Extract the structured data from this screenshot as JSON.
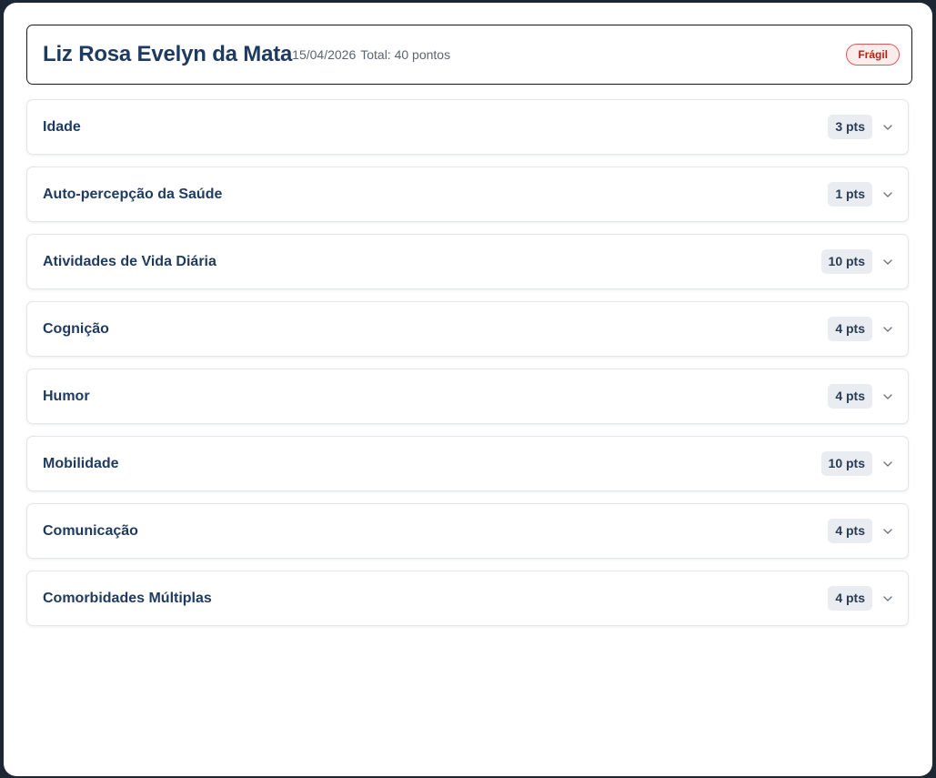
{
  "header": {
    "patient_name": "Liz Rosa Evelyn da Mata",
    "date": "15/04/2026",
    "total": "Total: 40 pontos",
    "status": "Frágil"
  },
  "sections": [
    {
      "label": "Idade",
      "points": "3 pts"
    },
    {
      "label": "Auto-percepção da Saúde",
      "points": "1 pts"
    },
    {
      "label": "Atividades de Vida Diária",
      "points": "10 pts"
    },
    {
      "label": "Cognição",
      "points": "4 pts"
    },
    {
      "label": "Humor",
      "points": "4 pts"
    },
    {
      "label": "Mobilidade",
      "points": "10 pts"
    },
    {
      "label": "Comunicação",
      "points": "4 pts"
    },
    {
      "label": "Comorbidades Múltiplas",
      "points": "4 pts"
    }
  ],
  "icons": {
    "expand": "chevron-down-icon"
  },
  "colors": {
    "title": "#1e3a5f",
    "status_text": "#b42318",
    "status_bg": "#fdecec",
    "status_border": "#d65a5a",
    "badge_bg": "#e9edf2"
  }
}
